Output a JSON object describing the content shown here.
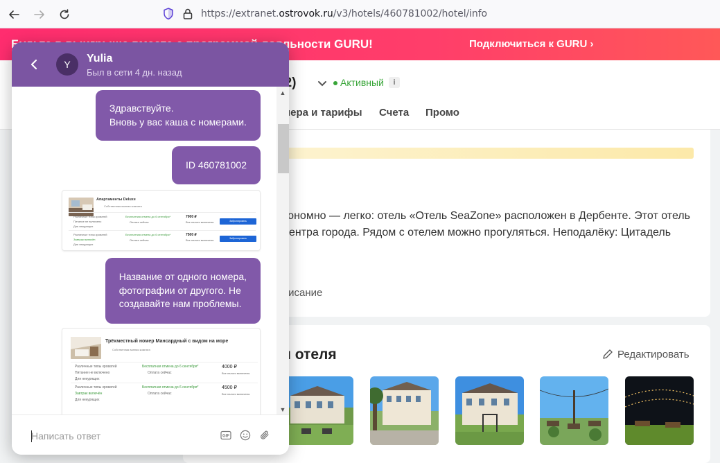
{
  "browser": {
    "url_prefix": "https://extranet.",
    "url_host": "ostrovok.ru",
    "url_path": "/v3/hotels/460781002/hotel/info"
  },
  "promo": {
    "text": "Будьте в выигрыше вместе с программой лояльности GURU!",
    "link": "Подключиться к GURU"
  },
  "header": {
    "hotel_id": "02)",
    "status": "Активный",
    "info_icon": "i",
    "tabs": [
      "мера и тарифы",
      "Счета",
      "Промо"
    ]
  },
  "description": {
    "text": "кономно — легко: отель «Отель SeaZone» расположен в Дербенте. Этот отель центра города. Рядом с отелем можно прогуляться. Неподалёку: Цитадель",
    "link": "писание"
  },
  "photos_section": {
    "title": "и отеля",
    "edit": "Редактировать"
  },
  "chat": {
    "agent_name": "Yulia",
    "agent_initial": "Y",
    "agent_status": "Был в сети 4 дн. назад",
    "messages": [
      {
        "type": "text",
        "text": "Здравствуйте.\nВновь у вас каша с номерами."
      },
      {
        "type": "text",
        "text": "ID 460781002"
      },
      {
        "type": "image",
        "caption": "Апартаменты Deluxe"
      },
      {
        "type": "text",
        "text": "Название от одного номера,\nфотографии от другого. Не\nсоздавайте нам проблемы."
      },
      {
        "type": "image",
        "caption": "Трёхместный номер Мансардный с видом на море"
      }
    ],
    "shot1": {
      "title": "Апартаменты Deluxe",
      "sub": "Собственная ванная комната",
      "beds": "Различные типы кроватей",
      "meal_no": "Питание не включено",
      "guests": "Для некурящих",
      "cancel": "Бесплатная отмена до 6 сентября*",
      "pay_now": "Оплата сейчас",
      "price1": "7000 ₽",
      "price2": "7500 ₽",
      "breakfast": "Завтрак включён",
      "book": "Забронировать",
      "total_note": "Все налоги включены"
    },
    "shot2": {
      "title": "Трёхместный номер Мансардный с видом на море",
      "sub": "Собственная ванная комната",
      "beds": "Различные типы кроватей",
      "meal_no": "Питание не включено",
      "guests": "Для некурящих",
      "cancel": "Бесплатная отмена до 6 сентября*",
      "pay_now": "Оплата сейчас",
      "price1": "4000 ₽",
      "price2": "4500 ₽",
      "breakfast": "Завтрак включён",
      "total_note": "Все налоги включены"
    },
    "composer_placeholder": "Написать ответ",
    "gif_label": "GIF"
  },
  "colors": {
    "chat_accent": "#7b55a2",
    "bubble": "#8159a9",
    "promo": "#ff3e6a",
    "status_green": "#38a538"
  }
}
